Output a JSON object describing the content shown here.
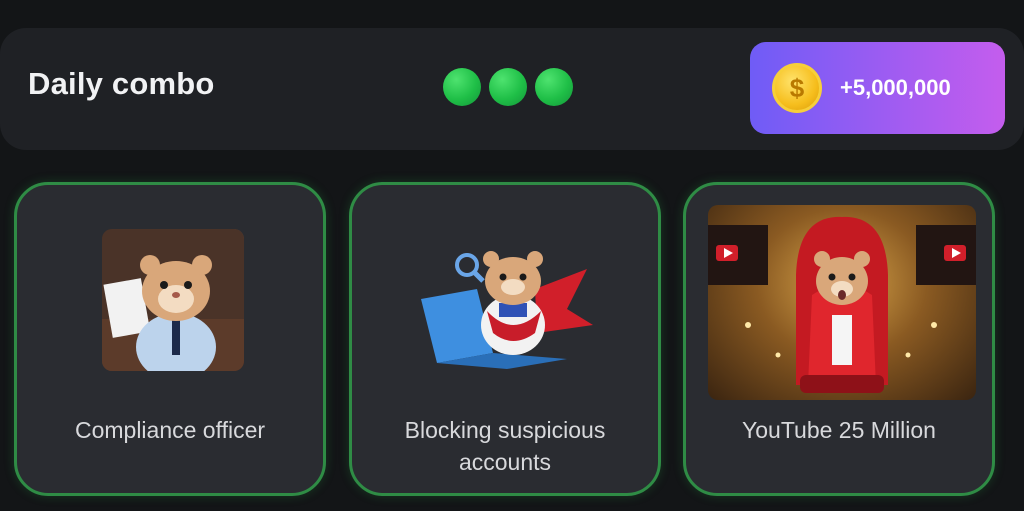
{
  "combo": {
    "title": "Daily combo",
    "found_count": 3,
    "reward": "+5,000,000",
    "coin_symbol": "$"
  },
  "cards": [
    {
      "label": "Compliance officer",
      "icon": "hamster-office-icon"
    },
    {
      "label": "Blocking suspicious accounts",
      "icon": "hamster-laptop-hero-icon"
    },
    {
      "label": "YouTube 25 Million",
      "icon": "hamster-youtube-throne-icon"
    }
  ],
  "colors": {
    "accent_green": "#1fbf47",
    "card_border": "#2f8c45",
    "pill_start": "#6f5cf6",
    "pill_end": "#c45ded",
    "coin": "#f6be1d"
  }
}
